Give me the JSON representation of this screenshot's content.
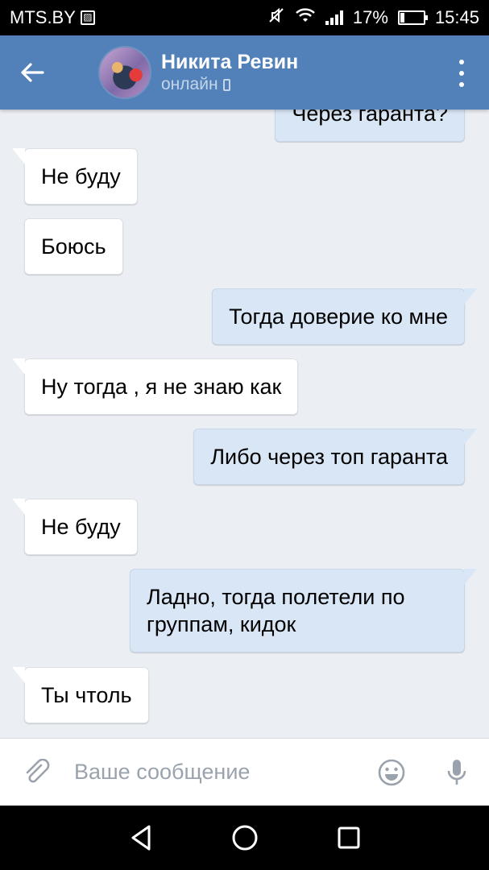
{
  "status_bar": {
    "carrier": "MTS.BY",
    "battery_percent": "17%",
    "battery_level": 0.17,
    "time": "15:45",
    "icons": [
      "sim-icon",
      "mute-icon",
      "wifi-icon",
      "signal-icon",
      "battery-icon"
    ]
  },
  "header": {
    "contact_name": "Никита Ревин",
    "contact_status": "онлайн",
    "icons": [
      "back-arrow-icon",
      "avatar",
      "mobile-icon",
      "more-vertical-icon"
    ]
  },
  "messages": [
    {
      "direction": "out",
      "text": "Через гаранта?"
    },
    {
      "direction": "in",
      "text": "Не буду"
    },
    {
      "direction": "in",
      "text": "Боюсь"
    },
    {
      "direction": "out",
      "text": "Тогда доверие ко мне"
    },
    {
      "direction": "in",
      "text": "Ну тогда , я не знаю как"
    },
    {
      "direction": "out",
      "text": "Либо через топ гаранта"
    },
    {
      "direction": "in",
      "text": "Не буду"
    },
    {
      "direction": "out",
      "text": "Ладно, тогда полетели по группам, кидок"
    },
    {
      "direction": "in",
      "text": "Ты чтоль"
    }
  ],
  "composer": {
    "placeholder": "Ваше сообщение",
    "value": "",
    "icons": [
      "paperclip-icon",
      "emoji-icon",
      "microphone-icon"
    ]
  },
  "nav_bar": {
    "icons": [
      "back-triangle-icon",
      "home-circle-icon",
      "recents-square-icon"
    ]
  }
}
